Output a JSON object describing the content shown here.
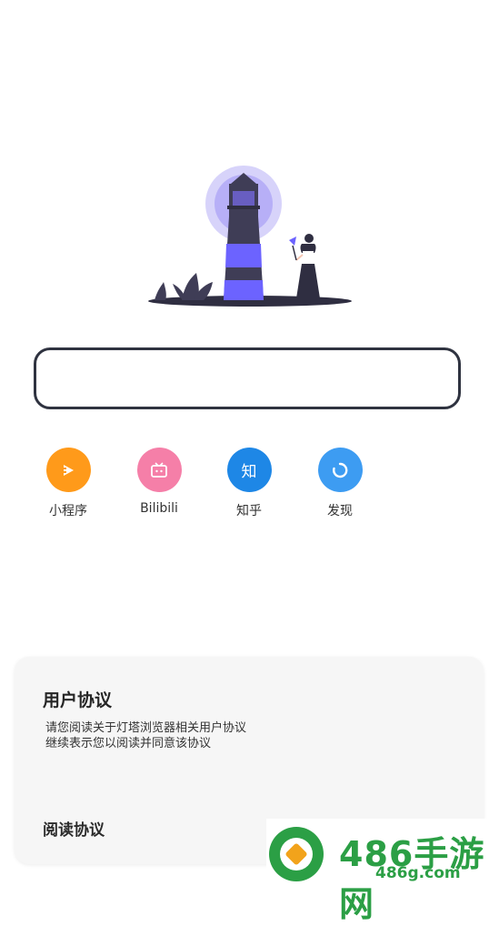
{
  "search": {
    "value": "",
    "placeholder": ""
  },
  "shortcuts": [
    {
      "label": "小程序",
      "color": "#ff9a1a",
      "icon": "miniprogram-icon"
    },
    {
      "label": "Bilibili",
      "color": "#f57fa8",
      "icon": "tv-icon"
    },
    {
      "label": "知乎",
      "color": "#1e87e6",
      "icon_text": "知",
      "icon": "zhihu-icon"
    },
    {
      "label": "发现",
      "color": "#3d9cf2",
      "icon": "discover-icon"
    }
  ],
  "agreement": {
    "title": "用户协议",
    "line1": "请您阅读关于灯塔浏览器相关用户协议",
    "line2": "继续表示您以阅读并同意该协议",
    "read_link": "阅读协议"
  },
  "watermark": {
    "brand": "486手游网",
    "domain": "486g.com"
  },
  "colors": {
    "accent": "#7b6cf0",
    "dark": "#2f2e41",
    "watermark": "#2b9f45"
  }
}
